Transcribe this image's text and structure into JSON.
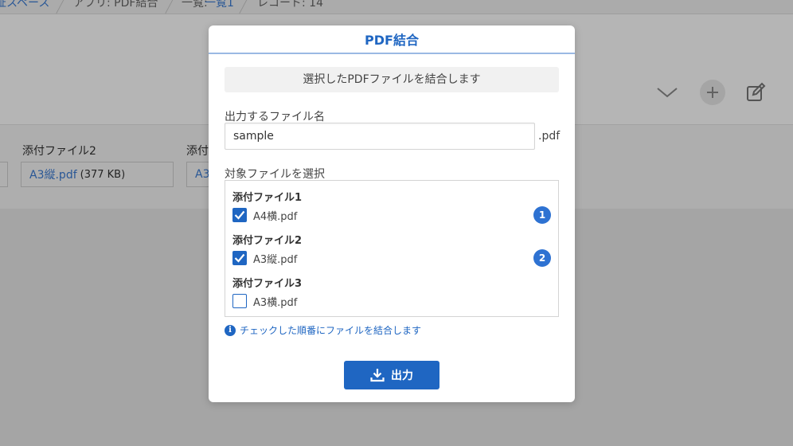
{
  "breadcrumb": {
    "items": [
      "証スペース",
      "アプリ: PDF結合",
      "一覧:",
      "一覧1",
      "レコード: 14"
    ]
  },
  "toolbar": {
    "icons": [
      "chevron-down-icon",
      "plus-icon",
      "edit-icon"
    ]
  },
  "record_fields": {
    "attachment2_label": "添付ファイル2",
    "attachment2_file": "A3縦.pdf",
    "attachment2_size": "(377 KB)",
    "attachment3_label": "添付",
    "attachment3_file": "A3"
  },
  "modal": {
    "title": "PDF結合",
    "info": "選択したPDFファイルを結合します",
    "filename_label": "出力するファイル名",
    "filename_value": "sample",
    "extension": ".pdf",
    "select_label": "対象ファイルを選択",
    "groups": [
      {
        "title": "添付ファイル1",
        "file": "A4横.pdf",
        "checked": true,
        "order": "1"
      },
      {
        "title": "添付ファイル2",
        "file": "A3縦.pdf",
        "checked": true,
        "order": "2"
      },
      {
        "title": "添付ファイル3",
        "file": "A3横.pdf",
        "checked": false,
        "order": ""
      }
    ],
    "hint": "チェックした順番にファイルを結合します",
    "output_button": "出力"
  },
  "colors": {
    "primary": "#1f66c2",
    "badge": "#2e72d2",
    "link": "#3b7bd3"
  }
}
